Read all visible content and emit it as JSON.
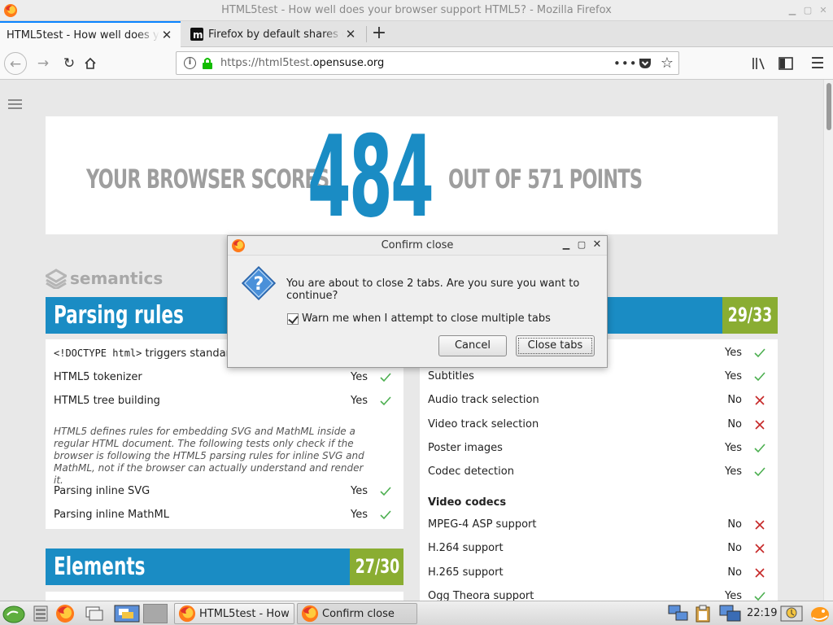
{
  "window": {
    "title": "HTML5test - How well does your browser support HTML5? - Mozilla Firefox"
  },
  "tabs": [
    {
      "label": "HTML5test - How well does your browser support HTML5?",
      "active": true
    },
    {
      "label": "Firefox by default shares data",
      "active": false
    }
  ],
  "navbar": {
    "url_prefix": "https://html5test.",
    "url_domain": "opensuse.org",
    "info_glyph": "i"
  },
  "score": {
    "prefix": "YOUR BROWSER SCORES",
    "value": "484",
    "suffix": "OUT OF 571 POINTS"
  },
  "category": "semantics",
  "left_section": {
    "title": "Parsing rules",
    "score": "29/33",
    "rows": [
      {
        "code": "<!DOCTYPE html>",
        "text": " triggers standards",
        "result": "",
        "pass": true
      },
      {
        "text": "HTML5 tokenizer",
        "result": "Yes",
        "pass": true
      },
      {
        "text": "HTML5 tree building",
        "result": "Yes",
        "pass": true
      }
    ],
    "note": "HTML5 defines rules for embedding SVG and MathML inside a regular HTML document. The following tests only check if the browser is following the HTML5 parsing rules for inline SVG and MathML, not if the browser can actually understand and render it.",
    "rows2": [
      {
        "text": "Parsing inline SVG",
        "result": "Yes",
        "pass": true
      },
      {
        "text": "Parsing inline MathML",
        "result": "Yes",
        "pass": true
      }
    ]
  },
  "elements_section": {
    "title": "Elements",
    "score": "27/30"
  },
  "right_section": {
    "rows": [
      {
        "text": "",
        "result": "Yes",
        "pass": true
      },
      {
        "text": "Subtitles",
        "result": "Yes",
        "pass": true
      },
      {
        "text": "Audio track selection",
        "result": "No",
        "pass": false
      },
      {
        "text": "Video track selection",
        "result": "No",
        "pass": false
      },
      {
        "text": "Poster images",
        "result": "Yes",
        "pass": true
      },
      {
        "text": "Codec detection",
        "result": "Yes",
        "pass": true
      }
    ],
    "codecs_heading": "Video codecs",
    "codecs": [
      {
        "text": "MPEG-4 ASP support",
        "result": "No",
        "pass": false
      },
      {
        "text": "H.264 support",
        "result": "No",
        "pass": false
      },
      {
        "text": "H.265 support",
        "result": "No",
        "pass": false
      },
      {
        "text": "Ogg Theora support",
        "result": "Yes",
        "pass": true
      }
    ]
  },
  "dialog": {
    "title": "Confirm close",
    "message": "You are about to close 2 tabs. Are you sure you want to continue?",
    "checkbox_label": "Warn me when I attempt to close multiple tabs",
    "checkbox_checked": true,
    "cancel_label": "Cancel",
    "confirm_label": "Close tabs"
  },
  "taskbar": {
    "tasks": [
      {
        "label": "HTML5test - How ...",
        "active": false
      },
      {
        "label": "Confirm close",
        "active": true
      }
    ],
    "clock": "22:19"
  },
  "colors": {
    "accent_blue": "#1a8cc4",
    "score_green": "#8aad32",
    "pass_green": "#4caf50",
    "fail_red": "#c62828",
    "firefox_tab_accent": "#0a84ff"
  }
}
